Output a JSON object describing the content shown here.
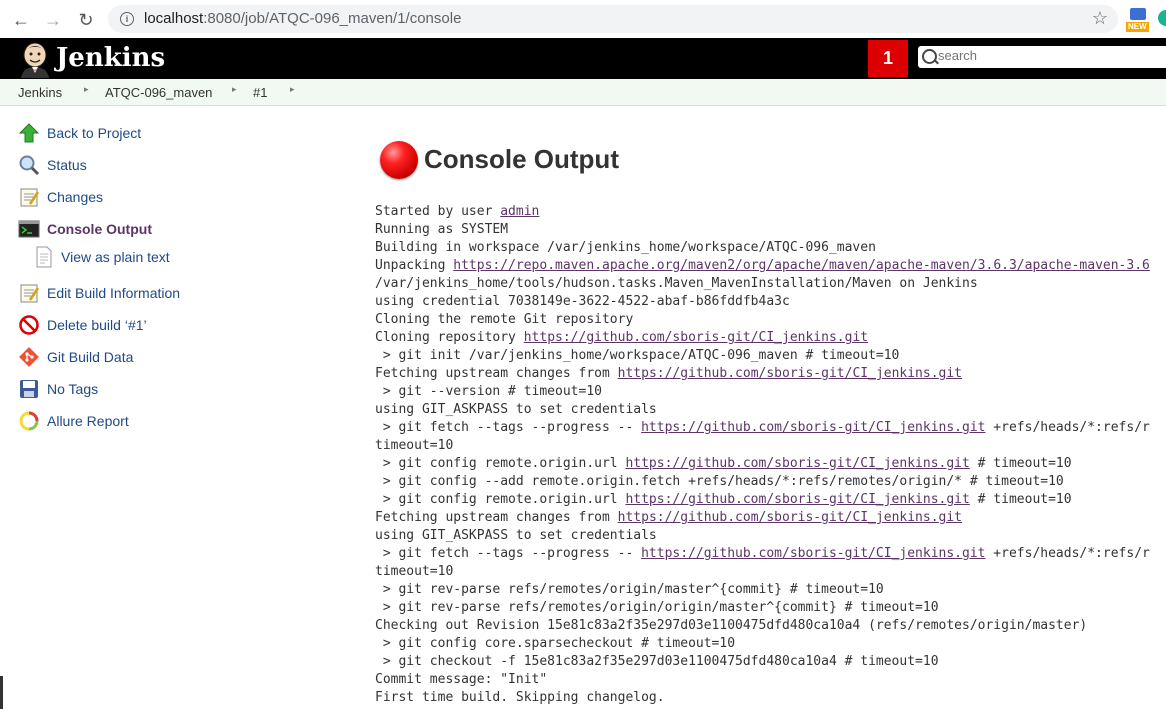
{
  "browser": {
    "url_host": "localhost",
    "url_rest": ":8080/job/ATQC-096_maven/1/console",
    "new_badge": "NEW"
  },
  "header": {
    "title": "Jenkins",
    "notification_count": "1",
    "search_placeholder": "search"
  },
  "breadcrumb": [
    "Jenkins",
    "ATQC-096_maven",
    "#1"
  ],
  "sidebar": {
    "items": [
      {
        "label": "Back to Project",
        "icon": "up-arrow-icon"
      },
      {
        "label": "Status",
        "icon": "magnifier-icon"
      },
      {
        "label": "Changes",
        "icon": "notepad-icon"
      },
      {
        "label": "Console Output",
        "icon": "terminal-icon"
      },
      {
        "label": "View as plain text",
        "icon": "document-icon"
      },
      {
        "label": "Edit Build Information",
        "icon": "notepad-pencil-icon"
      },
      {
        "label": "Delete build ‘#1’",
        "icon": "no-entry-icon"
      },
      {
        "label": "Git Build Data",
        "icon": "git-icon"
      },
      {
        "label": "No Tags",
        "icon": "save-disk-icon"
      },
      {
        "label": "Allure Report",
        "icon": "allure-icon"
      }
    ]
  },
  "main": {
    "title": "Console Output",
    "status": "failed",
    "status_color": "#dd0000",
    "log_lines": [
      {
        "parts": [
          {
            "t": "Started by user "
          },
          {
            "t": "admin",
            "link": true
          }
        ]
      },
      {
        "parts": [
          {
            "t": "Running as SYSTEM"
          }
        ]
      },
      {
        "parts": [
          {
            "t": "Building in workspace /var/jenkins_home/workspace/ATQC-096_maven"
          }
        ]
      },
      {
        "parts": [
          {
            "t": "Unpacking "
          },
          {
            "t": "https://repo.maven.apache.org/maven2/org/apache/maven/apache-maven/3.6.3/apache-maven-3.6",
            "link": true
          }
        ]
      },
      {
        "parts": [
          {
            "t": "/var/jenkins_home/tools/hudson.tasks.Maven_MavenInstallation/Maven on Jenkins"
          }
        ]
      },
      {
        "parts": [
          {
            "t": "using credential 7038149e-3622-4522-abaf-b86fddfb4a3c"
          }
        ]
      },
      {
        "parts": [
          {
            "t": "Cloning the remote Git repository"
          }
        ]
      },
      {
        "parts": [
          {
            "t": "Cloning repository "
          },
          {
            "t": "https://github.com/sboris-git/CI_jenkins.git",
            "link": true
          }
        ]
      },
      {
        "parts": [
          {
            "t": " > git init /var/jenkins_home/workspace/ATQC-096_maven # timeout=10"
          }
        ]
      },
      {
        "parts": [
          {
            "t": "Fetching upstream changes from "
          },
          {
            "t": "https://github.com/sboris-git/CI_jenkins.git",
            "link": true
          }
        ]
      },
      {
        "parts": [
          {
            "t": " > git --version # timeout=10"
          }
        ]
      },
      {
        "parts": [
          {
            "t": "using GIT_ASKPASS to set credentials"
          }
        ]
      },
      {
        "parts": [
          {
            "t": " > git fetch --tags --progress -- "
          },
          {
            "t": "https://github.com/sboris-git/CI_jenkins.git",
            "link": true
          },
          {
            "t": " +refs/heads/*:refs/r"
          }
        ]
      },
      {
        "parts": [
          {
            "t": "timeout=10"
          }
        ]
      },
      {
        "parts": [
          {
            "t": " > git config remote.origin.url "
          },
          {
            "t": "https://github.com/sboris-git/CI_jenkins.git",
            "link": true
          },
          {
            "t": " # timeout=10"
          }
        ]
      },
      {
        "parts": [
          {
            "t": " > git config --add remote.origin.fetch +refs/heads/*:refs/remotes/origin/* # timeout=10"
          }
        ]
      },
      {
        "parts": [
          {
            "t": " > git config remote.origin.url "
          },
          {
            "t": "https://github.com/sboris-git/CI_jenkins.git",
            "link": true
          },
          {
            "t": " # timeout=10"
          }
        ]
      },
      {
        "parts": [
          {
            "t": "Fetching upstream changes from "
          },
          {
            "t": "https://github.com/sboris-git/CI_jenkins.git",
            "link": true
          }
        ]
      },
      {
        "parts": [
          {
            "t": "using GIT_ASKPASS to set credentials"
          }
        ]
      },
      {
        "parts": [
          {
            "t": " > git fetch --tags --progress -- "
          },
          {
            "t": "https://github.com/sboris-git/CI_jenkins.git",
            "link": true
          },
          {
            "t": " +refs/heads/*:refs/r"
          }
        ]
      },
      {
        "parts": [
          {
            "t": "timeout=10"
          }
        ]
      },
      {
        "parts": [
          {
            "t": " > git rev-parse refs/remotes/origin/master^{commit} # timeout=10"
          }
        ]
      },
      {
        "parts": [
          {
            "t": " > git rev-parse refs/remotes/origin/origin/master^{commit} # timeout=10"
          }
        ]
      },
      {
        "parts": [
          {
            "t": "Checking out Revision 15e81c83a2f35e297d03e1100475dfd480ca10a4 (refs/remotes/origin/master)"
          }
        ]
      },
      {
        "parts": [
          {
            "t": " > git config core.sparsecheckout # timeout=10"
          }
        ]
      },
      {
        "parts": [
          {
            "t": " > git checkout -f 15e81c83a2f35e297d03e1100475dfd480ca10a4 # timeout=10"
          }
        ]
      },
      {
        "parts": [
          {
            "t": "Commit message: \"Init\""
          }
        ]
      },
      {
        "parts": [
          {
            "t": "First time build. Skipping changelog."
          }
        ]
      }
    ]
  }
}
